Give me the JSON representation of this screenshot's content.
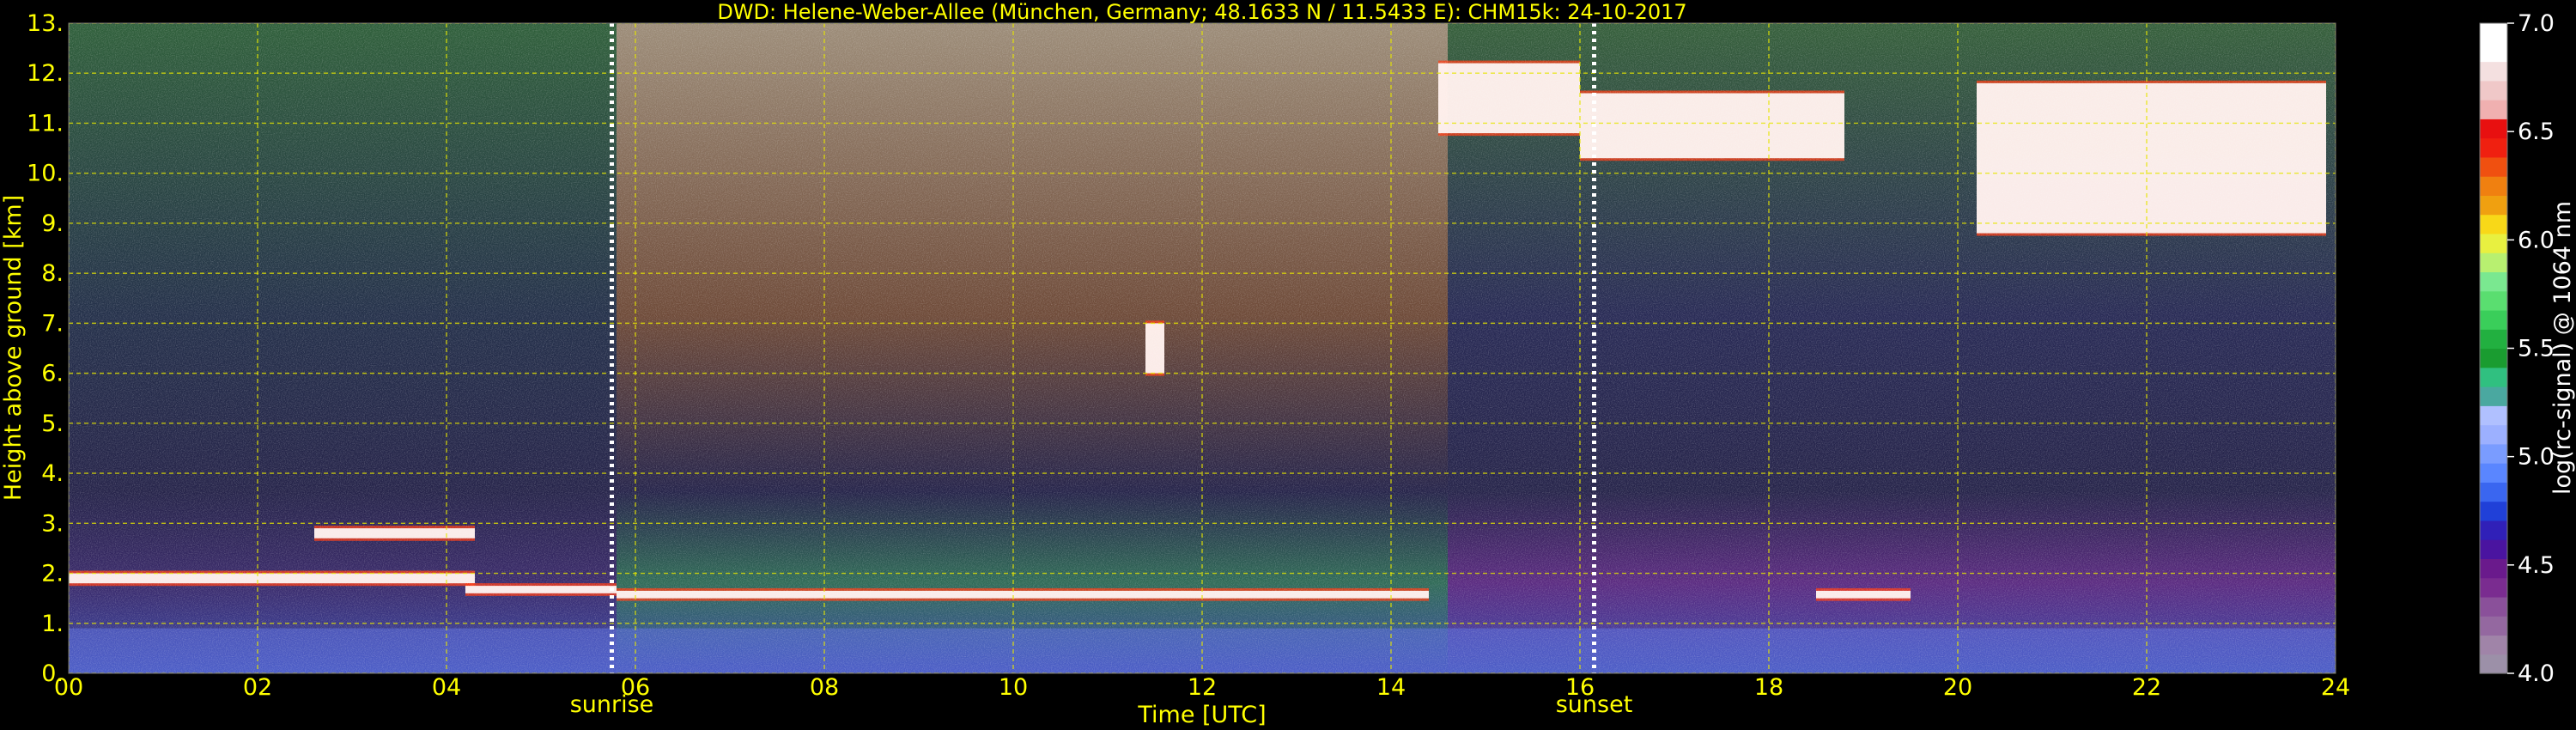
{
  "chart_data": {
    "type": "heatmap",
    "title": "DWD: Helene-Weber-Allee (München, Germany; 48.1633 N / 11.5433 E):    CHM15k: 24-10-2017",
    "xlabel": "Time [UTC]",
    "ylabel": "Height above ground [km]",
    "xlim": [
      0,
      24
    ],
    "ylim": [
      0,
      13
    ],
    "x_ticks": [
      0,
      2,
      4,
      6,
      8,
      10,
      12,
      14,
      16,
      18,
      20,
      22,
      24
    ],
    "x_tick_labels": [
      "00",
      "02",
      "04",
      "06",
      "08",
      "10",
      "12",
      "14",
      "16",
      "18",
      "20",
      "22",
      "24"
    ],
    "y_ticks": [
      0,
      1,
      2,
      3,
      4,
      5,
      6,
      7,
      8,
      9,
      10,
      11,
      12,
      13
    ],
    "y_tick_labels": [
      "0.",
      "1.",
      "2.",
      "3.",
      "4.",
      "5.",
      "6.",
      "7.",
      "8.",
      "9.",
      "10.",
      "11.",
      "12.",
      "13."
    ],
    "grid": true,
    "markers": [
      {
        "label": "sunrise",
        "time": 5.75
      },
      {
        "label": "sunset",
        "time": 16.15
      }
    ],
    "colorbar": {
      "label": "log(rc-signal) @ 1064 nm",
      "range": [
        4.0,
        7.0
      ],
      "ticks": [
        4.0,
        4.5,
        5.0,
        5.5,
        6.0,
        6.5,
        7.0
      ],
      "tick_labels": [
        "4.0",
        "4.5",
        "5.0",
        "5.5",
        "6.0",
        "6.5",
        "7.0"
      ]
    },
    "cloud_layers": [
      {
        "t0": 0.0,
        "t1": 4.3,
        "h0": 1.8,
        "h1": 2.0
      },
      {
        "t0": 2.6,
        "t1": 4.3,
        "h0": 2.7,
        "h1": 2.9
      },
      {
        "t0": 4.2,
        "t1": 5.8,
        "h0": 1.6,
        "h1": 1.75
      },
      {
        "t0": 5.8,
        "t1": 14.4,
        "h0": 1.5,
        "h1": 1.65
      },
      {
        "t0": 18.5,
        "t1": 19.5,
        "h0": 1.5,
        "h1": 1.65
      },
      {
        "t0": 11.4,
        "t1": 11.6,
        "h0": 6.0,
        "h1": 7.0
      },
      {
        "t0": 14.5,
        "t1": 16.0,
        "h0": 10.8,
        "h1": 12.2
      },
      {
        "t0": 16.0,
        "t1": 18.8,
        "h0": 10.3,
        "h1": 11.6
      },
      {
        "t0": 20.2,
        "t1": 23.9,
        "h0": 8.8,
        "h1": 11.8
      }
    ]
  }
}
